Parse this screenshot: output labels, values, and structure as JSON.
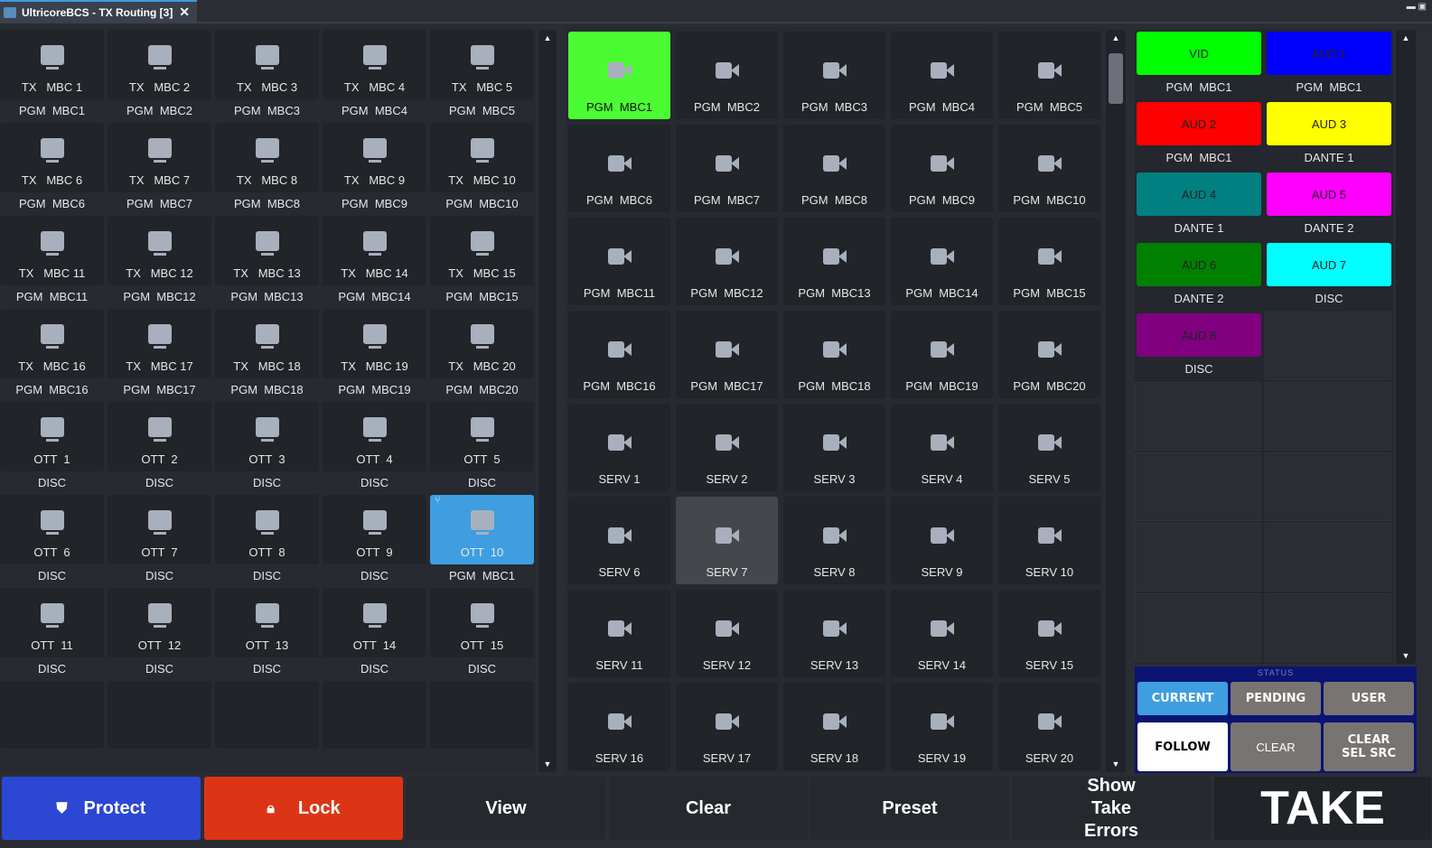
{
  "window": {
    "title": "UltricoreBCS - TX Routing [3]",
    "close": "✕",
    "controls": "▬ ▣"
  },
  "destinations": [
    {
      "top": "TX   MBC 1",
      "bottom": "PGM  MBC1"
    },
    {
      "top": "TX   MBC 2",
      "bottom": "PGM  MBC2"
    },
    {
      "top": "TX   MBC 3",
      "bottom": "PGM  MBC3"
    },
    {
      "top": "TX   MBC 4",
      "bottom": "PGM  MBC4"
    },
    {
      "top": "TX   MBC 5",
      "bottom": "PGM  MBC5"
    },
    {
      "top": "TX   MBC 6",
      "bottom": "PGM  MBC6"
    },
    {
      "top": "TX   MBC 7",
      "bottom": "PGM  MBC7"
    },
    {
      "top": "TX   MBC 8",
      "bottom": "PGM  MBC8"
    },
    {
      "top": "TX   MBC 9",
      "bottom": "PGM  MBC9"
    },
    {
      "top": "TX   MBC 10",
      "bottom": "PGM  MBC10"
    },
    {
      "top": "TX   MBC 11",
      "bottom": "PGM  MBC11"
    },
    {
      "top": "TX   MBC 12",
      "bottom": "PGM  MBC12"
    },
    {
      "top": "TX   MBC 13",
      "bottom": "PGM  MBC13"
    },
    {
      "top": "TX   MBC 14",
      "bottom": "PGM  MBC14"
    },
    {
      "top": "TX   MBC 15",
      "bottom": "PGM  MBC15"
    },
    {
      "top": "TX   MBC 16",
      "bottom": "PGM  MBC16"
    },
    {
      "top": "TX   MBC 17",
      "bottom": "PGM  MBC17"
    },
    {
      "top": "TX   MBC 18",
      "bottom": "PGM  MBC18"
    },
    {
      "top": "TX   MBC 19",
      "bottom": "PGM  MBC19"
    },
    {
      "top": "TX   MBC 20",
      "bottom": "PGM  MBC20"
    },
    {
      "top": "OTT  1",
      "bottom": "DISC"
    },
    {
      "top": "OTT  2",
      "bottom": "DISC"
    },
    {
      "top": "OTT  3",
      "bottom": "DISC"
    },
    {
      "top": "OTT  4",
      "bottom": "DISC"
    },
    {
      "top": "OTT  5",
      "bottom": "DISC"
    },
    {
      "top": "OTT  6",
      "bottom": "DISC"
    },
    {
      "top": "OTT  7",
      "bottom": "DISC"
    },
    {
      "top": "OTT  8",
      "bottom": "DISC"
    },
    {
      "top": "OTT  9",
      "bottom": "DISC"
    },
    {
      "top": "OTT  10",
      "bottom": "PGM  MBC1",
      "selected": true
    },
    {
      "top": "OTT  11",
      "bottom": "DISC"
    },
    {
      "top": "OTT  12",
      "bottom": "DISC"
    },
    {
      "top": "OTT  13",
      "bottom": "DISC"
    },
    {
      "top": "OTT  14",
      "bottom": "DISC"
    },
    {
      "top": "OTT  15",
      "bottom": "DISC"
    }
  ],
  "sources": [
    {
      "label": "PGM  MBC1",
      "state": "active"
    },
    {
      "label": "PGM  MBC2"
    },
    {
      "label": "PGM  MBC3"
    },
    {
      "label": "PGM  MBC4"
    },
    {
      "label": "PGM  MBC5"
    },
    {
      "label": "PGM  MBC6"
    },
    {
      "label": "PGM  MBC7"
    },
    {
      "label": "PGM  MBC8"
    },
    {
      "label": "PGM  MBC9"
    },
    {
      "label": "PGM  MBC10"
    },
    {
      "label": "PGM  MBC11"
    },
    {
      "label": "PGM  MBC12"
    },
    {
      "label": "PGM  MBC13"
    },
    {
      "label": "PGM  MBC14"
    },
    {
      "label": "PGM  MBC15"
    },
    {
      "label": "PGM  MBC16"
    },
    {
      "label": "PGM  MBC17"
    },
    {
      "label": "PGM  MBC18"
    },
    {
      "label": "PGM  MBC19"
    },
    {
      "label": "PGM  MBC20"
    },
    {
      "label": "SERV 1"
    },
    {
      "label": "SERV 2"
    },
    {
      "label": "SERV 3"
    },
    {
      "label": "SERV 4"
    },
    {
      "label": "SERV 5"
    },
    {
      "label": "SERV 6"
    },
    {
      "label": "SERV 7",
      "state": "hover"
    },
    {
      "label": "SERV 8"
    },
    {
      "label": "SERV 9"
    },
    {
      "label": "SERV 10"
    },
    {
      "label": "SERV 11"
    },
    {
      "label": "SERV 12"
    },
    {
      "label": "SERV 13"
    },
    {
      "label": "SERV 14"
    },
    {
      "label": "SERV 15"
    },
    {
      "label": "SERV 16"
    },
    {
      "label": "SERV 17"
    },
    {
      "label": "SERV 18"
    },
    {
      "label": "SERV 19"
    },
    {
      "label": "SERV 20"
    }
  ],
  "levels": [
    {
      "label": "VID",
      "source": "PGM  MBC1",
      "color": "#00ff00"
    },
    {
      "label": "AUD 1",
      "source": "PGM  MBC1",
      "color": "#0000ff"
    },
    {
      "label": "AUD 2",
      "source": "PGM  MBC1",
      "color": "#ff0000"
    },
    {
      "label": "AUD 3",
      "source": "DANTE 1",
      "color": "#ffff00"
    },
    {
      "label": "AUD 4",
      "source": "DANTE 1",
      "color": "#008080"
    },
    {
      "label": "AUD 5",
      "source": "DANTE 2",
      "color": "#ff00ff"
    },
    {
      "label": "AUD 6",
      "source": "DANTE 2",
      "color": "#008000"
    },
    {
      "label": "AUD 7",
      "source": "DISC",
      "color": "#00ffff"
    },
    {
      "label": "AUD 8",
      "source": "DISC",
      "color": "#800080"
    }
  ],
  "status": {
    "title": "STATUS",
    "current": "CURRENT",
    "pending": "PENDING",
    "user": "USER",
    "follow": "FOLLOW",
    "clear": "CLEAR",
    "clear_sel_src": "CLEAR SEL SRC"
  },
  "bottom": {
    "protect": "Protect",
    "lock": "Lock",
    "view": "View",
    "clear": "Clear",
    "preset": "Preset",
    "show_take_errors": "Show Take Errors",
    "take": "TAKE"
  },
  "colors": {
    "selected": "#3e9ee0",
    "active_source": "#4cfc32",
    "protect": "#2b47d4",
    "lock": "#dc3515"
  }
}
